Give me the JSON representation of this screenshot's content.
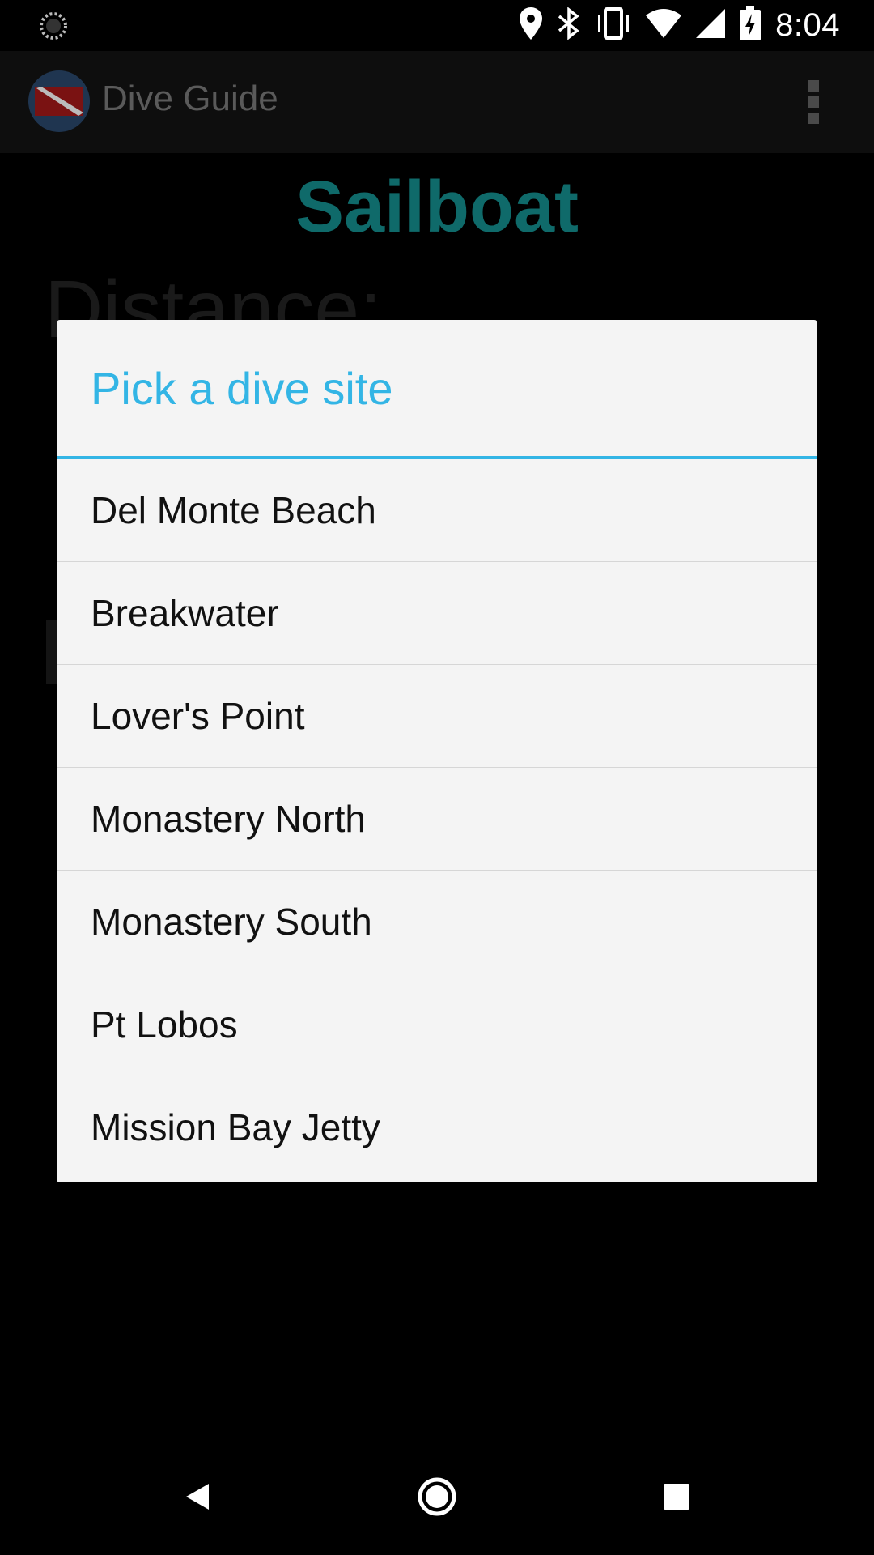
{
  "status_bar": {
    "time": "8:04",
    "icons": [
      "sync-icon",
      "location-icon",
      "bluetooth-icon",
      "vibrate-icon",
      "wifi-icon",
      "signal-icon",
      "battery-charging-icon"
    ]
  },
  "app_bar": {
    "title": "Dive Guide",
    "logo": "dive-flag-icon",
    "menu_icon": "overflow-menu-icon"
  },
  "page": {
    "title": "Sailboat",
    "distance_label": "Distance:"
  },
  "dialog": {
    "title": "Pick a dive site",
    "items": [
      {
        "label": "Del Monte Beach"
      },
      {
        "label": "Breakwater"
      },
      {
        "label": "Lover's Point"
      },
      {
        "label": "Monastery North"
      },
      {
        "label": "Monastery South"
      },
      {
        "label": "Pt Lobos"
      },
      {
        "label": "Mission Bay Jetty"
      }
    ]
  },
  "nav_bar": {
    "icons": [
      "back-icon",
      "home-icon",
      "recents-icon"
    ]
  },
  "colors": {
    "accent": "#33b5e5",
    "title_teal": "#0f6a6a",
    "dialog_bg": "#f4f4f4"
  }
}
